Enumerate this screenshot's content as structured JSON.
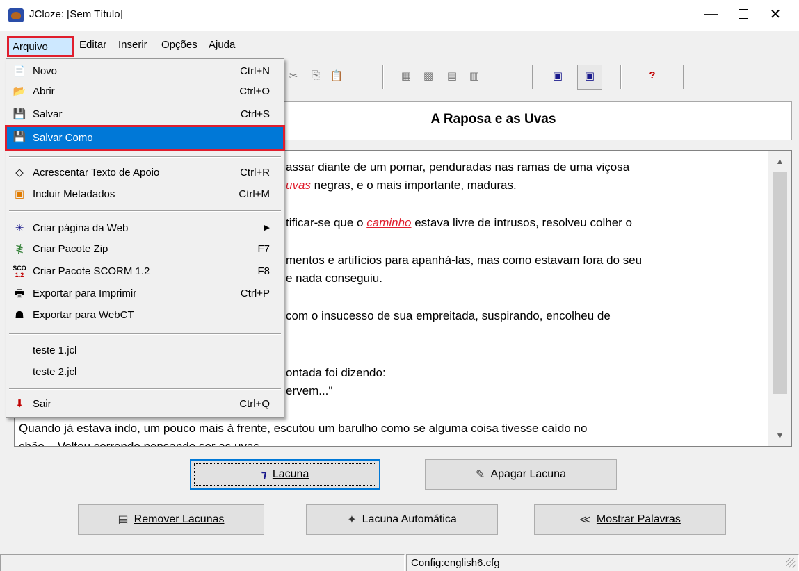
{
  "window": {
    "title": "JCloze: [Sem Título]",
    "minimize": "—",
    "close": "✕"
  },
  "menubar": {
    "items": [
      "Arquivo",
      "Editar",
      "Inserir",
      "Opções",
      "Ajuda"
    ]
  },
  "arquivo_menu": {
    "items": [
      {
        "label": "Novo",
        "shortcut": "Ctrl+N",
        "icon": "new-document-icon"
      },
      {
        "label": "Abrir",
        "shortcut": "Ctrl+O",
        "icon": "open-folder-icon"
      },
      {
        "label": "Salvar",
        "shortcut": "Ctrl+S",
        "icon": "save-disk-icon"
      },
      {
        "label": "Salvar Como",
        "shortcut": "",
        "icon": "save-as-icon",
        "selected": true
      },
      {
        "label": "Acrescentar Texto de Apoio",
        "shortcut": "Ctrl+R",
        "icon": "link-icon"
      },
      {
        "label": "Incluir Metadados",
        "shortcut": "Ctrl+M",
        "icon": "metadata-icon"
      },
      {
        "label": "Criar página da Web",
        "shortcut": "",
        "icon": "web-icon",
        "submenu": true
      },
      {
        "label": "Criar Pacote Zip",
        "shortcut": "F7",
        "icon": "zip-icon"
      },
      {
        "label": "Criar Pacote SCORM 1.2",
        "shortcut": "F8",
        "icon": "scorm-icon"
      },
      {
        "label": "Exportar para Imprimir",
        "shortcut": "Ctrl+P",
        "icon": "printer-icon"
      },
      {
        "label": "Exportar para WebCT",
        "shortcut": "",
        "icon": "webct-icon"
      },
      {
        "label": "teste 1.jcl",
        "shortcut": "",
        "icon": ""
      },
      {
        "label": "teste 2.jcl",
        "shortcut": "",
        "icon": ""
      },
      {
        "label": "Sair",
        "shortcut": "Ctrl+Q",
        "icon": "exit-arrow-icon"
      }
    ]
  },
  "document": {
    "title": "A Raposa e as Uvas",
    "lines": [
      {
        "pre": "assar diante de um pomar, penduradas nas ramas de uma viçosa",
        "gap": "",
        "post": ""
      },
      {
        "pre": "",
        "gap": "uvas",
        "post": " negras, e o mais importante, maduras."
      },
      {
        "pre": "tificar-se que o ",
        "gap": "caminho",
        "post": " estava livre de intrusos, resolveu colher o"
      },
      {
        "pre": "mentos e artifícios para apanhá-las, mas como estavam fora do seu",
        "gap": "",
        "post": ""
      },
      {
        "pre": "e nada conseguiu.",
        "gap": "",
        "post": ""
      },
      {
        "pre": "com o insucesso de sua empreitada, suspirando, encolheu de",
        "gap": "",
        "post": ""
      },
      {
        "pre": "ontada foi dizendo:",
        "gap": "",
        "post": ""
      },
      {
        "pre": "ervem...\"",
        "gap": "",
        "post": ""
      },
      {
        "pre": "Quando já estava indo, um pouco mais à frente, escutou um barulho como se alguma coisa tivesse caído no",
        "gap": "",
        "post": ""
      },
      {
        "pre": "chão... Voltou correndo pensando ser as uvas.",
        "gap": "",
        "post": ""
      }
    ]
  },
  "buttons": {
    "lacuna": "Lacuna",
    "apagar_lacuna": "Apagar Lacuna",
    "remover_lacunas": "Remover Lacunas",
    "lacuna_automatica": "Lacuna Automática",
    "mostrar_palavras": "Mostrar Palavras"
  },
  "status": {
    "config": "Config:english6.cfg"
  },
  "colors": {
    "highlight": "#0078d7",
    "annotation_red": "#e01e2d",
    "gap_word": "#e01e2d"
  }
}
